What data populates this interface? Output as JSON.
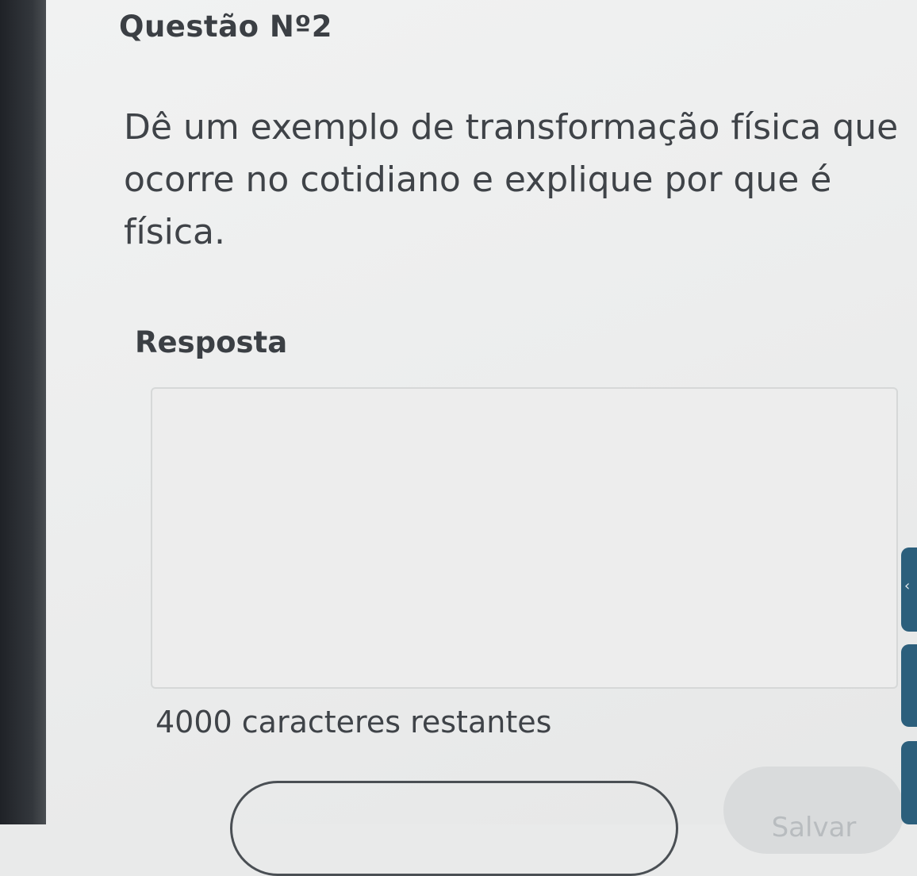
{
  "question": {
    "title": "Questão Nº2",
    "text": "Dê um exemplo de transformação física que ocorre no cotidiano e explique por que é física."
  },
  "answer": {
    "label": "Resposta",
    "value": "",
    "chars_remaining": "4000 caracteres restantes"
  },
  "actions": {
    "secondary_label": "",
    "save_label": "Salvar"
  },
  "side_tabs": {
    "arrow_icon": "chevron-left-icon"
  },
  "colors": {
    "accent": "#2c5f7c",
    "save_button_bg": "#d9dbdc",
    "text": "#3f4348"
  }
}
